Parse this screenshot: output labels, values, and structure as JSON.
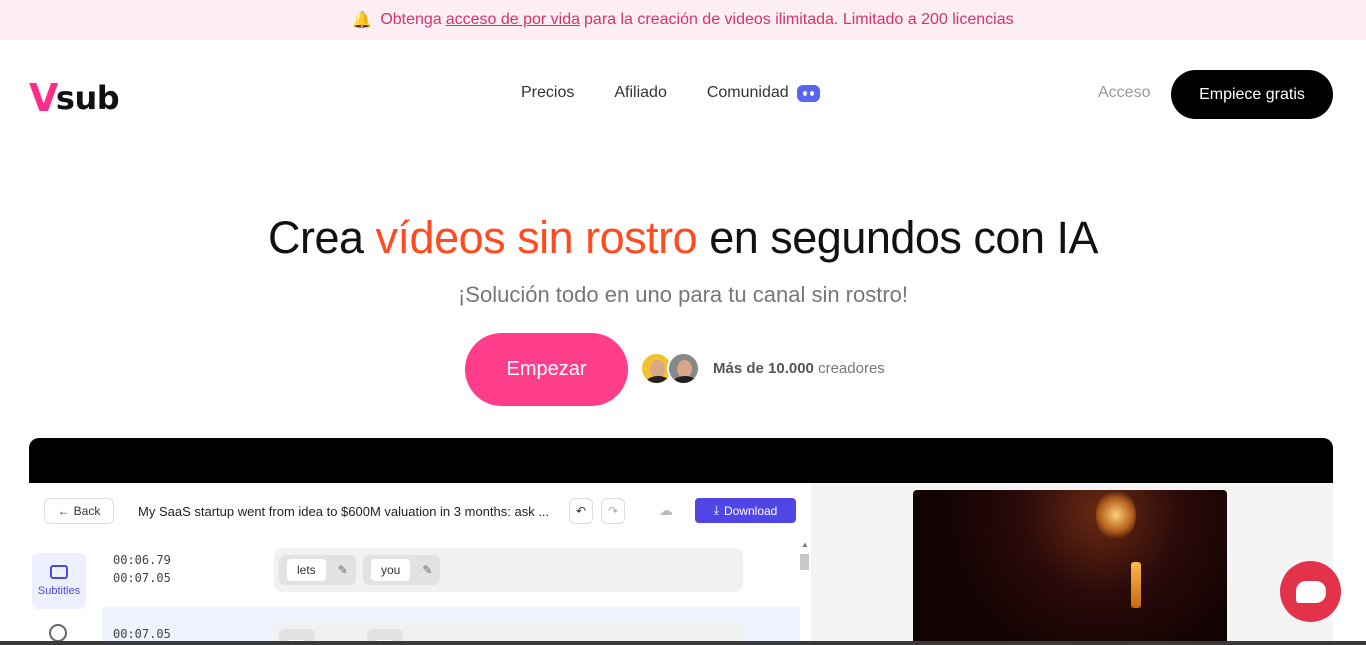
{
  "banner": {
    "pre": "Obtenga",
    "link": "acceso de por vida",
    "post": "para la creación de videos ilimitada. Limitado a 200 licencias",
    "icon": "bell-icon"
  },
  "nav": {
    "logo_v": "V",
    "logo_rest": "sub",
    "links": [
      "Precios",
      "Afiliado",
      "Comunidad"
    ],
    "login": "Acceso",
    "start_free": "Empiece gratis"
  },
  "hero": {
    "title_pre": "Crea",
    "title_accent": "vídeos sin rostro",
    "title_post": "en segundos con IA",
    "subtitle": "¡Solución todo en uno para tu canal sin rostro!",
    "cta": "Empezar",
    "creators_bold": "Más de 10.000",
    "creators_rest": "creadores"
  },
  "app": {
    "back": "Back",
    "video_title": "My SaaS startup went from idea to $600M valuation in 3 months: ask ...",
    "download": "Download",
    "side_tab": "Subtitles",
    "rows": [
      {
        "start": "00:06.79",
        "end": "00:07.05",
        "words": [
          "lets",
          "you"
        ]
      },
      {
        "start": "00:07.05",
        "end": "",
        "words": [
          "",
          ""
        ]
      }
    ]
  },
  "colors": {
    "accent": "#ff4b1f",
    "brand_pink": "#ff3d8b",
    "download_blue": "#4f46e5",
    "chat_red": "#e2334b"
  }
}
